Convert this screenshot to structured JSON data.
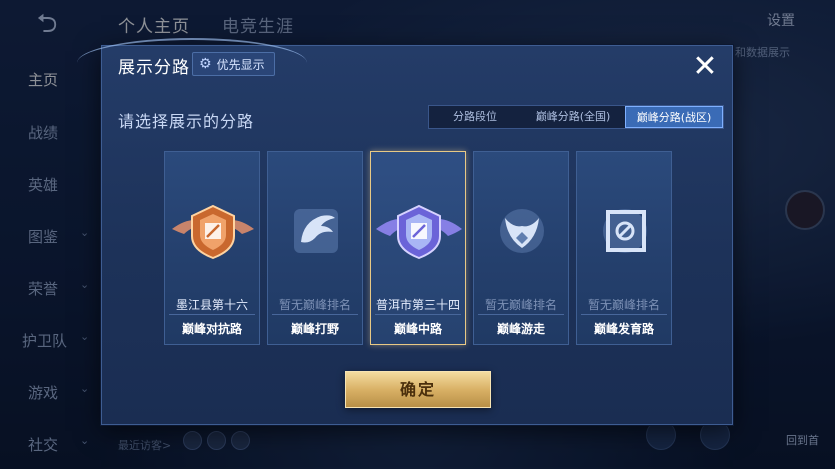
{
  "background": {
    "back_glyph": "⮌",
    "tabs": [
      "个人主页",
      "电竞生涯"
    ],
    "settings_label": "设置",
    "hint_text": "和数据展示",
    "sidebar": [
      {
        "label": "主页",
        "chevron": ""
      },
      {
        "label": "战绩",
        "chevron": ""
      },
      {
        "label": "英雄",
        "chevron": ""
      },
      {
        "label": "图鉴",
        "chevron": "⌄"
      },
      {
        "label": "荣誉",
        "chevron": "⌄"
      },
      {
        "label": "护卫队",
        "chevron": "⌄"
      },
      {
        "label": "游戏",
        "chevron": "⌄"
      },
      {
        "label": "社交",
        "chevron": "⌄"
      }
    ],
    "recent_visitors_label": "最近访客>",
    "back_home_label": "回到首"
  },
  "modal": {
    "title": "展示分路",
    "priority_button": {
      "icon": "gear-icon",
      "label": "优先显示"
    },
    "close_glyph": "✕",
    "subtitle": "请选择展示的分路",
    "segments": [
      {
        "label": "分路段位",
        "active": false
      },
      {
        "label": "巅峰分路(全国)",
        "active": false
      },
      {
        "label": "巅峰分路(战区)",
        "active": true
      }
    ],
    "cards": [
      {
        "name": "墨江县第十六",
        "role": "巅峰对抗路",
        "emblem": "ranked-orange",
        "selected": false,
        "ranked": true
      },
      {
        "name": "暂无巅峰排名",
        "role": "巅峰打野",
        "emblem": "jungle",
        "selected": false,
        "ranked": false
      },
      {
        "name": "普洱市第三十四",
        "role": "巅峰中路",
        "emblem": "ranked-purple",
        "selected": true,
        "ranked": true
      },
      {
        "name": "暂无巅峰排名",
        "role": "巅峰游走",
        "emblem": "roam",
        "selected": false,
        "ranked": false
      },
      {
        "name": "暂无巅峰排名",
        "role": "巅峰发育路",
        "emblem": "farm",
        "selected": false,
        "ranked": false
      }
    ],
    "confirm_label": "确定"
  },
  "colors": {
    "accent_gold": "#d9b166",
    "selected_border": "#e8c985",
    "segment_active": "#3a6bb6"
  }
}
